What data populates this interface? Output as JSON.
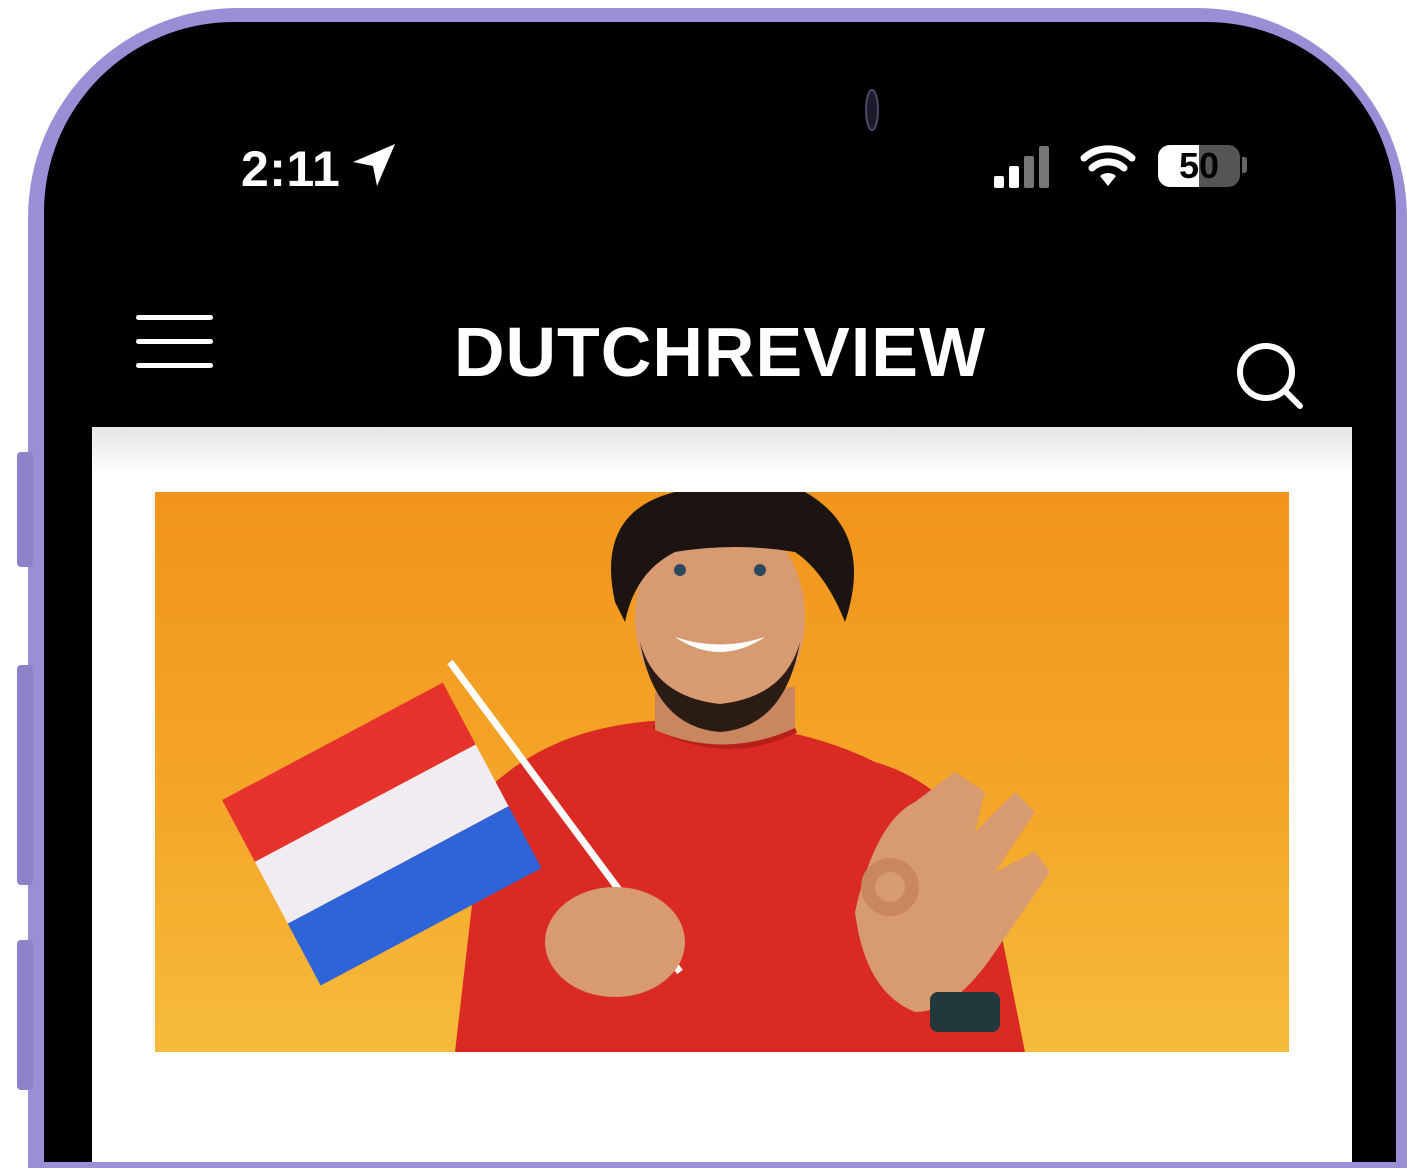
{
  "status_bar": {
    "time": "2:11",
    "battery": "50",
    "battery_level": 0.5,
    "icons": [
      "location-arrow-icon",
      "signal-icon",
      "wifi-icon",
      "battery-icon"
    ]
  },
  "header": {
    "brand": "DUTCHREVIEW",
    "icons": [
      "hamburger-menu-icon",
      "search-icon"
    ]
  },
  "hero_image": {
    "subject": "photo",
    "colors": {
      "background_top": "#f1941b",
      "background_bottom": "#f6bb3c",
      "shirt": "#d92b24"
    }
  },
  "colors": {
    "frame": "#9a8fd6",
    "screen": "#000000",
    "card": "#ffffff"
  }
}
